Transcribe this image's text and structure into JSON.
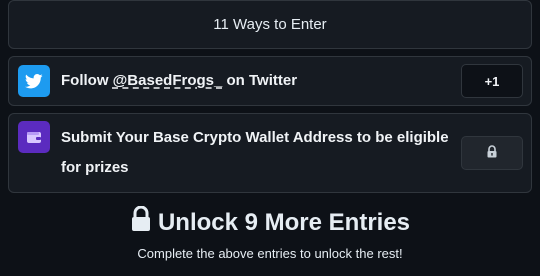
{
  "header": {
    "title": "11 Ways to Enter"
  },
  "entries": [
    {
      "icon": "twitter-bird-icon",
      "label_prefix": "Follow ",
      "handle": "@BasedFrogs_",
      "label_suffix": " on Twitter",
      "action": "+1",
      "accent": "#1d9bf0"
    },
    {
      "icon": "wallet-icon",
      "label": "Submit Your Base Crypto Wallet Address to be eligible for prizes",
      "action_icon": "lock-icon",
      "accent": "#5b2bbf"
    }
  ],
  "unlock": {
    "title": "Unlock 9 More Entries",
    "subtitle": "Complete the above entries to unlock the rest!"
  }
}
